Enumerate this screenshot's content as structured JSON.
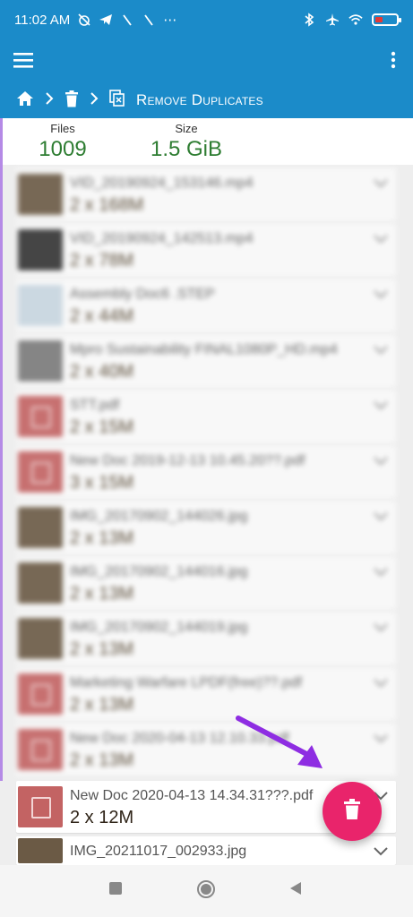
{
  "status_bar": {
    "time": "11:02 AM",
    "overflow": "⋯"
  },
  "breadcrumb": {
    "title": "Remove Duplicates"
  },
  "summary": {
    "files_label": "Files",
    "files_value": "1009",
    "size_label": "Size",
    "size_value": "1.5 GiB"
  },
  "files": [
    {
      "name": "VID_20190924_153146.mp4",
      "size": "2 x 168M",
      "thumb": "photo"
    },
    {
      "name": "VID_20190924_142513.mp4",
      "size": "2 x 78M",
      "thumb": "dark"
    },
    {
      "name": "Assembly Doc6 .STEP",
      "size": "2 x 44M",
      "thumb": "step"
    },
    {
      "name": "Mpro Sustainability FINAL1080P_HD.mp4",
      "size": "2 x 40M",
      "thumb": "video"
    },
    {
      "name": "STT.pdf",
      "size": "2 x 15M",
      "thumb": "pdf"
    },
    {
      "name": "New Doc 2019-12-13 10.45.20??.pdf",
      "size": "3 x 15M",
      "thumb": "pdf"
    },
    {
      "name": "IMG_20170902_144026.jpg",
      "size": "2 x 13M",
      "thumb": "photo"
    },
    {
      "name": "IMG_20170902_144016.jpg",
      "size": "2 x 13M",
      "thumb": "photo"
    },
    {
      "name": "IMG_20170902_144019.jpg",
      "size": "2 x 13M",
      "thumb": "photo"
    },
    {
      "name": "Marketing Warfare LPDF(free)??.pdf",
      "size": "2 x 13M",
      "thumb": "pdf"
    },
    {
      "name": "New Doc 2020-04-13 12.10.33.pdf",
      "size": "2 x 13M",
      "thumb": "pdf"
    },
    {
      "name": "New Doc 2020-04-13 14.34.31???.pdf",
      "size": "2 x 12M",
      "thumb": "pdf"
    },
    {
      "name": "IMG_20211017_002933.jpg",
      "size": "",
      "thumb": "photo"
    }
  ],
  "colors": {
    "appbar": "#1b8bc9",
    "fab": "#e9246b",
    "summary_value": "#2e7d32",
    "annotation_arrow": "#8e2de2"
  },
  "icons": {
    "menu": "menu-icon",
    "overflow": "more-vertical-icon",
    "home": "home-icon",
    "trash": "trash-icon",
    "duplicate": "duplicate-icon",
    "fab": "trash-icon"
  }
}
